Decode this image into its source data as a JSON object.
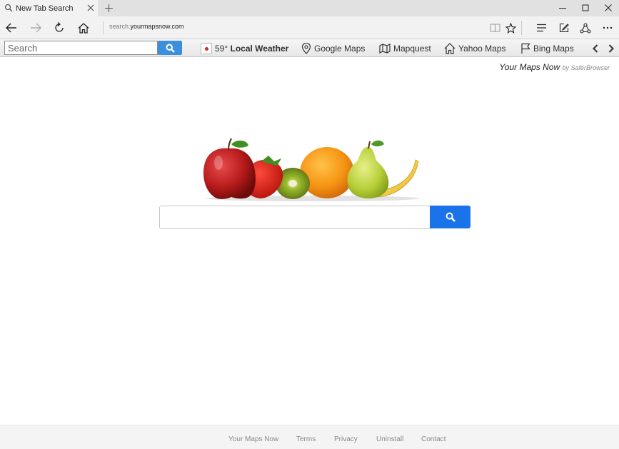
{
  "tab": {
    "title": "New Tab Search"
  },
  "address": {
    "host_prefix": "search.",
    "host_domain": "yourmapsnow.com"
  },
  "toolbar": {
    "search_placeholder": "Search",
    "weather": {
      "temp": "59°",
      "label": "Local Weather"
    },
    "links": [
      "Google Maps",
      "Mapquest",
      "Yahoo Maps",
      "Bing Maps"
    ]
  },
  "brand": {
    "name": "Your Maps Now",
    "by": "by SaferBrowser"
  },
  "main": {
    "search_placeholder": ""
  },
  "footer": {
    "links": [
      "Your Maps Now",
      "Terms",
      "Privacy",
      "Uninstall",
      "Contact"
    ]
  },
  "colors": {
    "toolbar_search_button": "#3b8fdd",
    "main_search_button": "#1a73e8"
  }
}
